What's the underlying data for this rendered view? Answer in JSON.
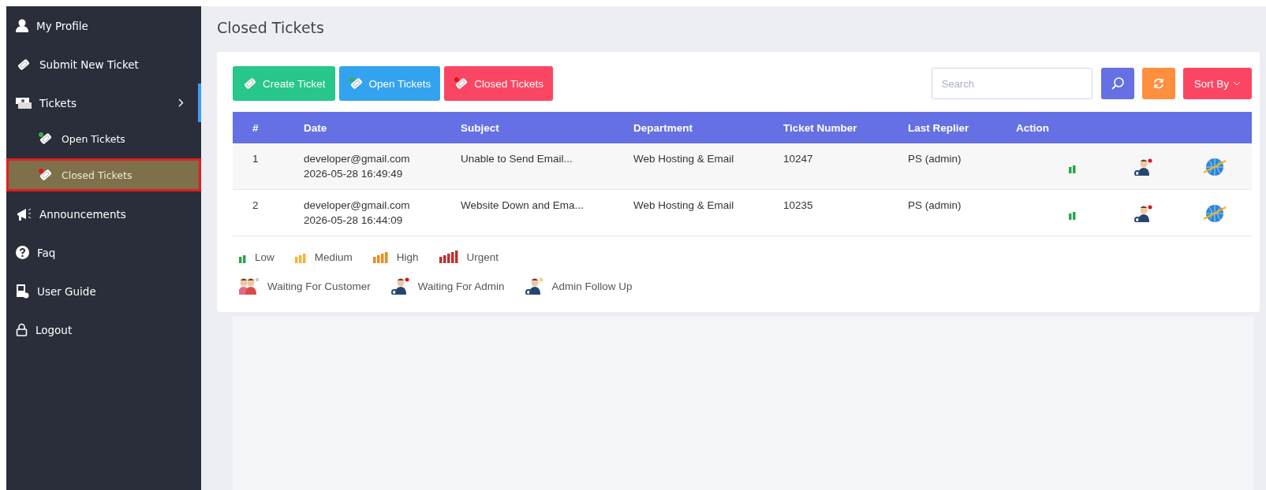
{
  "sidebar": {
    "items": [
      {
        "label": "My Profile",
        "kind": "user",
        "selected": false
      },
      {
        "label": "Submit New Ticket",
        "kind": "ticket",
        "selected": false
      },
      {
        "label": "Tickets",
        "kind": "tickets",
        "selected": false,
        "expanded": true,
        "children": [
          {
            "label": "Open Tickets",
            "kind": "open",
            "selected": false
          },
          {
            "label": "Closed Tickets",
            "kind": "closed",
            "selected": true
          }
        ]
      },
      {
        "label": "Announcements",
        "kind": "megaphone",
        "selected": false
      },
      {
        "label": "Faq",
        "kind": "help",
        "selected": false
      },
      {
        "label": "User Guide",
        "kind": "guide",
        "selected": false
      },
      {
        "label": "Logout",
        "kind": "lock",
        "selected": false
      }
    ]
  },
  "page_title": "Closed Tickets",
  "toolbar": {
    "buttons": [
      {
        "label": "Create Ticket",
        "kind": "create"
      },
      {
        "label": "Open Tickets",
        "kind": "open"
      },
      {
        "label": "Closed Tickets",
        "kind": "closed"
      }
    ],
    "search": {
      "placeholder": "Search"
    },
    "sort": {
      "label": "Sort By"
    }
  },
  "table": {
    "columns": [
      "#",
      "Date",
      "Subject",
      "Department",
      "Ticket Number",
      "Last Replier",
      "Action"
    ],
    "rows": [
      {
        "number": "1",
        "email": "developer@gmail.com",
        "date": "2026-05-28 16:49:49",
        "subject": "Unable to Send Email...",
        "department": "Web Hosting & Email",
        "ticket_number": "10247",
        "last_replier": "PS (admin)",
        "priority": {
          "kind": "low"
        },
        "status": {
          "kind": "waiting_admin"
        }
      },
      {
        "number": "2",
        "email": "developer@gmail.com",
        "date": "2026-05-28 16:44:09",
        "subject": "Website Down and Ema...",
        "department": "Web Hosting & Email",
        "ticket_number": "10235",
        "last_replier": "PS (admin)",
        "priority": {
          "kind": "low"
        },
        "status": {
          "kind": "waiting_admin"
        }
      }
    ]
  },
  "legend": {
    "priorities": [
      {
        "label": "Low",
        "kind": "low"
      },
      {
        "label": "Medium",
        "kind": "medium"
      },
      {
        "label": "High",
        "kind": "high"
      },
      {
        "label": "Urgent",
        "kind": "urgent"
      }
    ],
    "statuses": [
      {
        "label": "Waiting For Customer",
        "kind": "waiting_customer"
      },
      {
        "label": "Waiting For Admin",
        "kind": "waiting_admin"
      },
      {
        "label": "Admin Follow Up",
        "kind": "follow_up"
      }
    ]
  }
}
